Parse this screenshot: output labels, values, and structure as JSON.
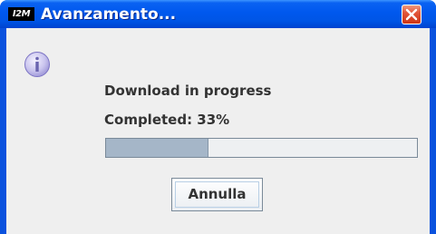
{
  "window": {
    "title": "Avanzamento...",
    "app_logo_text": "I2M"
  },
  "dialog": {
    "icon": "info-icon",
    "message": "Download in progress",
    "status": "Completed: 33%",
    "progress_value": 0.33,
    "cancel_label": "Annulla"
  },
  "colors": {
    "titlebar": "#0058ee",
    "content_bg": "#efefef",
    "progress_fill": "#a5b6c8",
    "close_button": "#e2563a"
  }
}
